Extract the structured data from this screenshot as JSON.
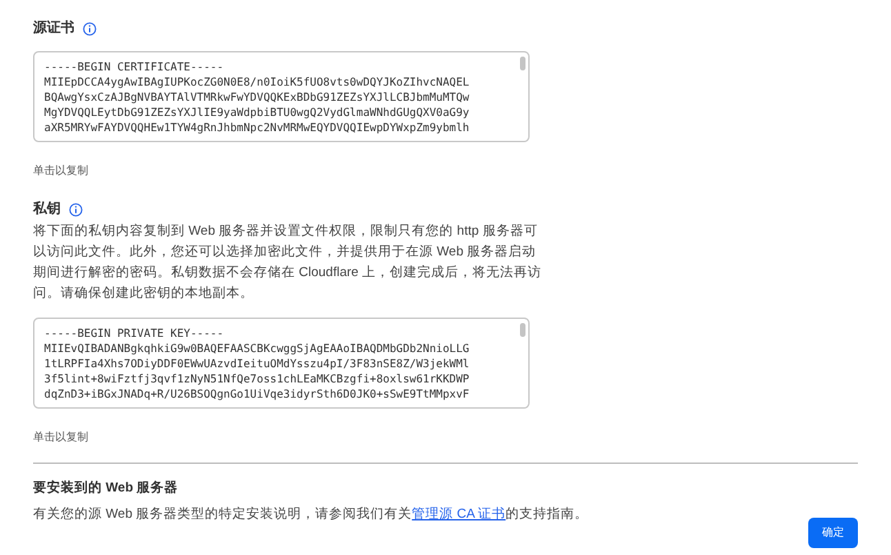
{
  "certificate": {
    "title": "源证书",
    "lines": [
      "-----BEGIN CERTIFICATE-----",
      "MIIEpDCCA4ygAwIBAgIUPKocZG0N0E8/n0IoiK5fUO8vts0wDQYJKoZIhvcNAQEL",
      "BQAwgYsxCzAJBgNVBAYTAlVTMRkwFwYDVQQKExBDbG91ZEZsYXJlLCBJbmMuMTQw",
      "MgYDVQQLEytDbG91ZEZsYXJlIE9yaWdpbiBTU0wgQ2VydGlmaWNhdGUgQXV0aG9y",
      "aXR5MRYwFAYDVQQHEw1TYW4gRnJhbmNpc2NvMRMwEQYDVQQIEwpDYWxpZm9ybmlh"
    ],
    "hint": "单击以复制"
  },
  "private_key": {
    "title": "私钥",
    "description": "将下面的私钥内容复制到 Web 服务器并设置文件权限，限制只有您的 http 服务器可以访问此文件。此外，您还可以选择加密此文件，并提供用于在源 Web 服务器启动期间进行解密的密码。私钥数据不会存储在 Cloudflare 上，创建完成后，将无法再访问。请确保创建此密钥的本地副本。",
    "lines": [
      "-----BEGIN PRIVATE KEY-----",
      "MIIEvQIBADANBgkqhkiG9w0BAQEFAASCBKcwggSjAgEAAoIBAQDMbGDb2NnioLLG",
      "1tLRPFIa4Xhs7ODiyDDF0EWwUAzvdIeituOMdYsszu4pI/3F83nSE8Z/W3jekWMl",
      "3f5lint+8wiFztfj3qvf1zNyN51NfQe7oss1chLEaMKCBzgfi+8oxlsw61rKKDWP",
      "dqZnD3+iBGxJNADq+R/U26BSOQgnGo1UiVqe3idyrSth6D0JK0+sSwE9TtMMpxvF"
    ],
    "hint": "单击以复制"
  },
  "web_server": {
    "title": "要安装到的 Web 服务器",
    "text_before": "有关您的源 Web 服务器类型的特定安装说明，请参阅我们有关",
    "link": "管理源 CA 证书",
    "text_after": "的支持指南。"
  },
  "buttons": [
    "确定"
  ]
}
